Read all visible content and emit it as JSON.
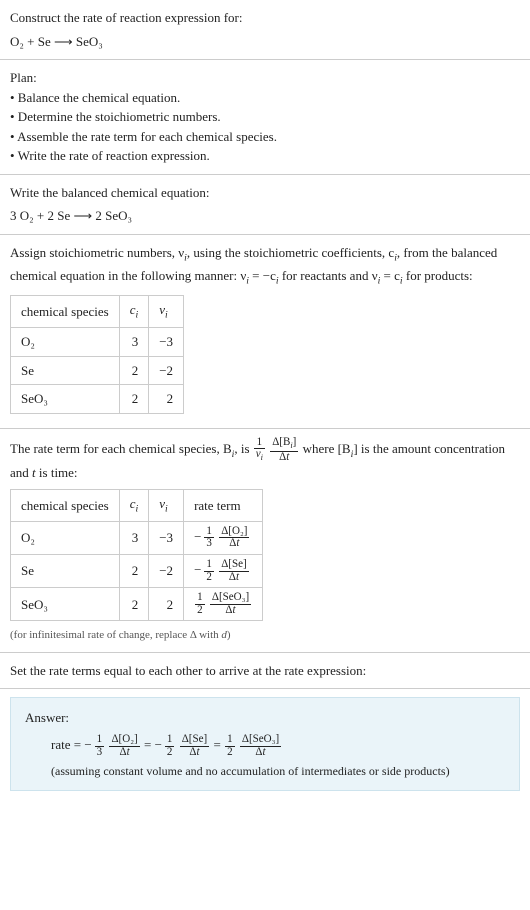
{
  "prompt": {
    "title": "Construct the rate of reaction expression for:",
    "equation": "O₂ + Se ⟶ SeO₃"
  },
  "plan": {
    "title": "Plan:",
    "items": [
      "• Balance the chemical equation.",
      "• Determine the stoichiometric numbers.",
      "• Assemble the rate term for each chemical species.",
      "• Write the rate of reaction expression."
    ]
  },
  "balanced": {
    "title": "Write the balanced chemical equation:",
    "equation": "3 O₂ + 2 Se ⟶ 2 SeO₃"
  },
  "assign": {
    "intro1": "Assign stoichiometric numbers, ν",
    "intro2": ", using the stoichiometric coefficients, c",
    "intro3": ", from the balanced chemical equation in the following manner: ν",
    "intro4": " = −c",
    "intro5": " for reactants and ν",
    "intro6": " = c",
    "intro7": " for products:"
  },
  "table1": {
    "headers": [
      "chemical species",
      "cᵢ",
      "νᵢ"
    ],
    "rows": [
      {
        "species": "O₂",
        "c": "3",
        "nu": "−3"
      },
      {
        "species": "Se",
        "c": "2",
        "nu": "−2"
      },
      {
        "species": "SeO₃",
        "c": "2",
        "nu": "2"
      }
    ]
  },
  "rateterm": {
    "intro1": "The rate term for each chemical species, B",
    "intro2": ", is ",
    "intro3": " where [B",
    "intro4": "] is the amount concentration and ",
    "t": "t",
    "intro5": " is time:"
  },
  "table2": {
    "headers": [
      "chemical species",
      "cᵢ",
      "νᵢ",
      "rate term"
    ],
    "rows": [
      {
        "species": "O₂",
        "c": "3",
        "nu": "−3",
        "sign": "−",
        "fnum": "1",
        "fden": "3",
        "dnum": "Δ[O₂]",
        "dden": "Δt"
      },
      {
        "species": "Se",
        "c": "2",
        "nu": "−2",
        "sign": "−",
        "fnum": "1",
        "fden": "2",
        "dnum": "Δ[Se]",
        "dden": "Δt"
      },
      {
        "species": "SeO₃",
        "c": "2",
        "nu": "2",
        "sign": "",
        "fnum": "1",
        "fden": "2",
        "dnum": "Δ[SeO₃]",
        "dden": "Δt"
      }
    ]
  },
  "caption": "(for infinitesimal rate of change, replace Δ with d)",
  "setequal": "Set the rate terms equal to each other to arrive at the rate expression:",
  "answer": {
    "label": "Answer:",
    "lhs": "rate = ",
    "terms": [
      {
        "sign": "−",
        "fnum": "1",
        "fden": "3",
        "dnum": "Δ[O₂]",
        "dden": "Δt",
        "sep": " = "
      },
      {
        "sign": "−",
        "fnum": "1",
        "fden": "2",
        "dnum": "Δ[Se]",
        "dden": "Δt",
        "sep": " = "
      },
      {
        "sign": "",
        "fnum": "1",
        "fden": "2",
        "dnum": "Δ[SeO₃]",
        "dden": "Δt",
        "sep": ""
      }
    ],
    "note": "(assuming constant volume and no accumulation of intermediates or side products)"
  },
  "sub_i": "i"
}
